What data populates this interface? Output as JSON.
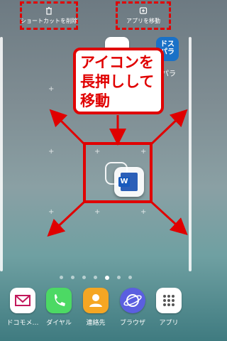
{
  "top_targets": [
    {
      "label": "ショートカットを削除",
      "icon": "trash-icon"
    },
    {
      "label": "アプリを移動",
      "icon": "move-app-icon"
    }
  ],
  "callout": {
    "lines": [
      "アイコンを",
      "長押しして",
      "移動"
    ]
  },
  "home": {
    "app_label_right": "パラ",
    "dpara_glyph": "ドス\nパラ",
    "word_letter": "W"
  },
  "page_indicator": {
    "count": 7,
    "active_index": 4
  },
  "dock": [
    {
      "label": "ドコモメ…",
      "icon": "docomo-mail-icon",
      "color": "#ffffff"
    },
    {
      "label": "ダイヤル",
      "icon": "phone-icon",
      "color": "#4cd964"
    },
    {
      "label": "連絡先",
      "icon": "contacts-icon",
      "color": "#f5a623"
    },
    {
      "label": "ブラウザ",
      "icon": "browser-icon",
      "color": "#5b5fe0"
    },
    {
      "label": "アプリ",
      "icon": "apps-grid-icon",
      "color": "#ffffff"
    }
  ],
  "colors": {
    "annotation_red": "#e00000"
  }
}
